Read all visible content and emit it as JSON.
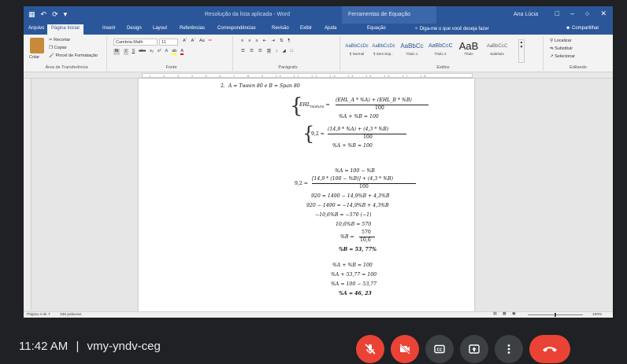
{
  "word": {
    "quick_access": [
      "save-icon",
      "undo-icon",
      "redo-icon",
      "customize-icon"
    ],
    "document_title": "Resolução da lista aplicada - Word",
    "contextual_tools": "Ferramentas de Equação",
    "user_name": "Ana Lúcia",
    "tabs": [
      "Arquivo",
      "Página Inicial",
      "Inserir",
      "Design",
      "Layout",
      "Referências",
      "Correspondências",
      "Revisão",
      "Exibir",
      "Ajuda",
      "Equação"
    ],
    "tell_me": "Diga-me o que você deseja fazer",
    "share": "Compartilhar",
    "ribbon": {
      "clipboard": {
        "paste": "Colar",
        "cut": "Recortar",
        "copy": "Copiar",
        "format_painter": "Pincel de Formatação",
        "caption": "Área de Transferência"
      },
      "font": {
        "name": "Cambria Math",
        "size": "11",
        "caption": "Fonte"
      },
      "paragraph_caption": "Parágrafo",
      "styles": {
        "items": [
          {
            "sample": "AaBbCcDc",
            "name": "¶ Normal"
          },
          {
            "sample": "AaBbCcDc",
            "name": "¶ Sem Esp..."
          },
          {
            "sample": "AaBbCc",
            "name": "Título 1"
          },
          {
            "sample": "AaBbCcC",
            "name": "Título 2"
          },
          {
            "sample": "AaB",
            "name": "Título"
          },
          {
            "sample": "AaBbCcC",
            "name": "Subtítulo"
          }
        ],
        "caption": "Estilos"
      },
      "editing": {
        "find": "Localizar",
        "replace": "Substituir",
        "select": "Selecionar",
        "caption": "Editando"
      }
    },
    "status": {
      "page": "Página 3 de 7",
      "words": "336 palavras",
      "zoom": "100%"
    }
  },
  "math": {
    "item": "2.",
    "item_text": "A = Tween 80 e B = Span 80",
    "s1_lhs": "EHL",
    "s1_sub": "mistura",
    "s1_num": "(EHL_A * %A) + (EHL_B * %B)",
    "s1_den": "100",
    "s1_line2": "%A + %B = 100",
    "s2_lhs": "9,2 =",
    "s2_num": "(14,9 * %A) + (4,3 * %B)",
    "s2_den": "100",
    "s2_line2": "%A + %B = 100",
    "l1": "%A = 100 − %B",
    "l2_lhs": "9,2 =",
    "l2_num": "[14,9 * (100 − %B)] + (4,3 * %B)",
    "l2_den": "100",
    "l3": "920 = 1490 − 14,9%B + 4,3%B",
    "l4": "920 − 1490 = −14,9%B + 4,3%B",
    "l5": "−10,6%B = −570     (−1)",
    "l6": "10,6%B = 570",
    "l7_lhs": "%B =",
    "l7_num": "570",
    "l7_den": "10,6",
    "l8": "%B = 53, 77%",
    "l9": "%A + %B = 100",
    "l10": "%A + 53,77 = 100",
    "l11": "%A = 100 − 53,77",
    "l12": "%A = 46, 23"
  },
  "meet": {
    "time": "11:42 AM",
    "separator": "|",
    "code": "vmy-yndv-ceg",
    "controls": [
      "mic-off-icon",
      "camera-off-icon",
      "captions-icon",
      "present-icon",
      "more-options-icon",
      "end-call-icon"
    ]
  },
  "colors": {
    "word_blue": "#2b579a",
    "meet_bg": "#202124",
    "red": "#ea4335",
    "control_gray": "#3c4043"
  }
}
